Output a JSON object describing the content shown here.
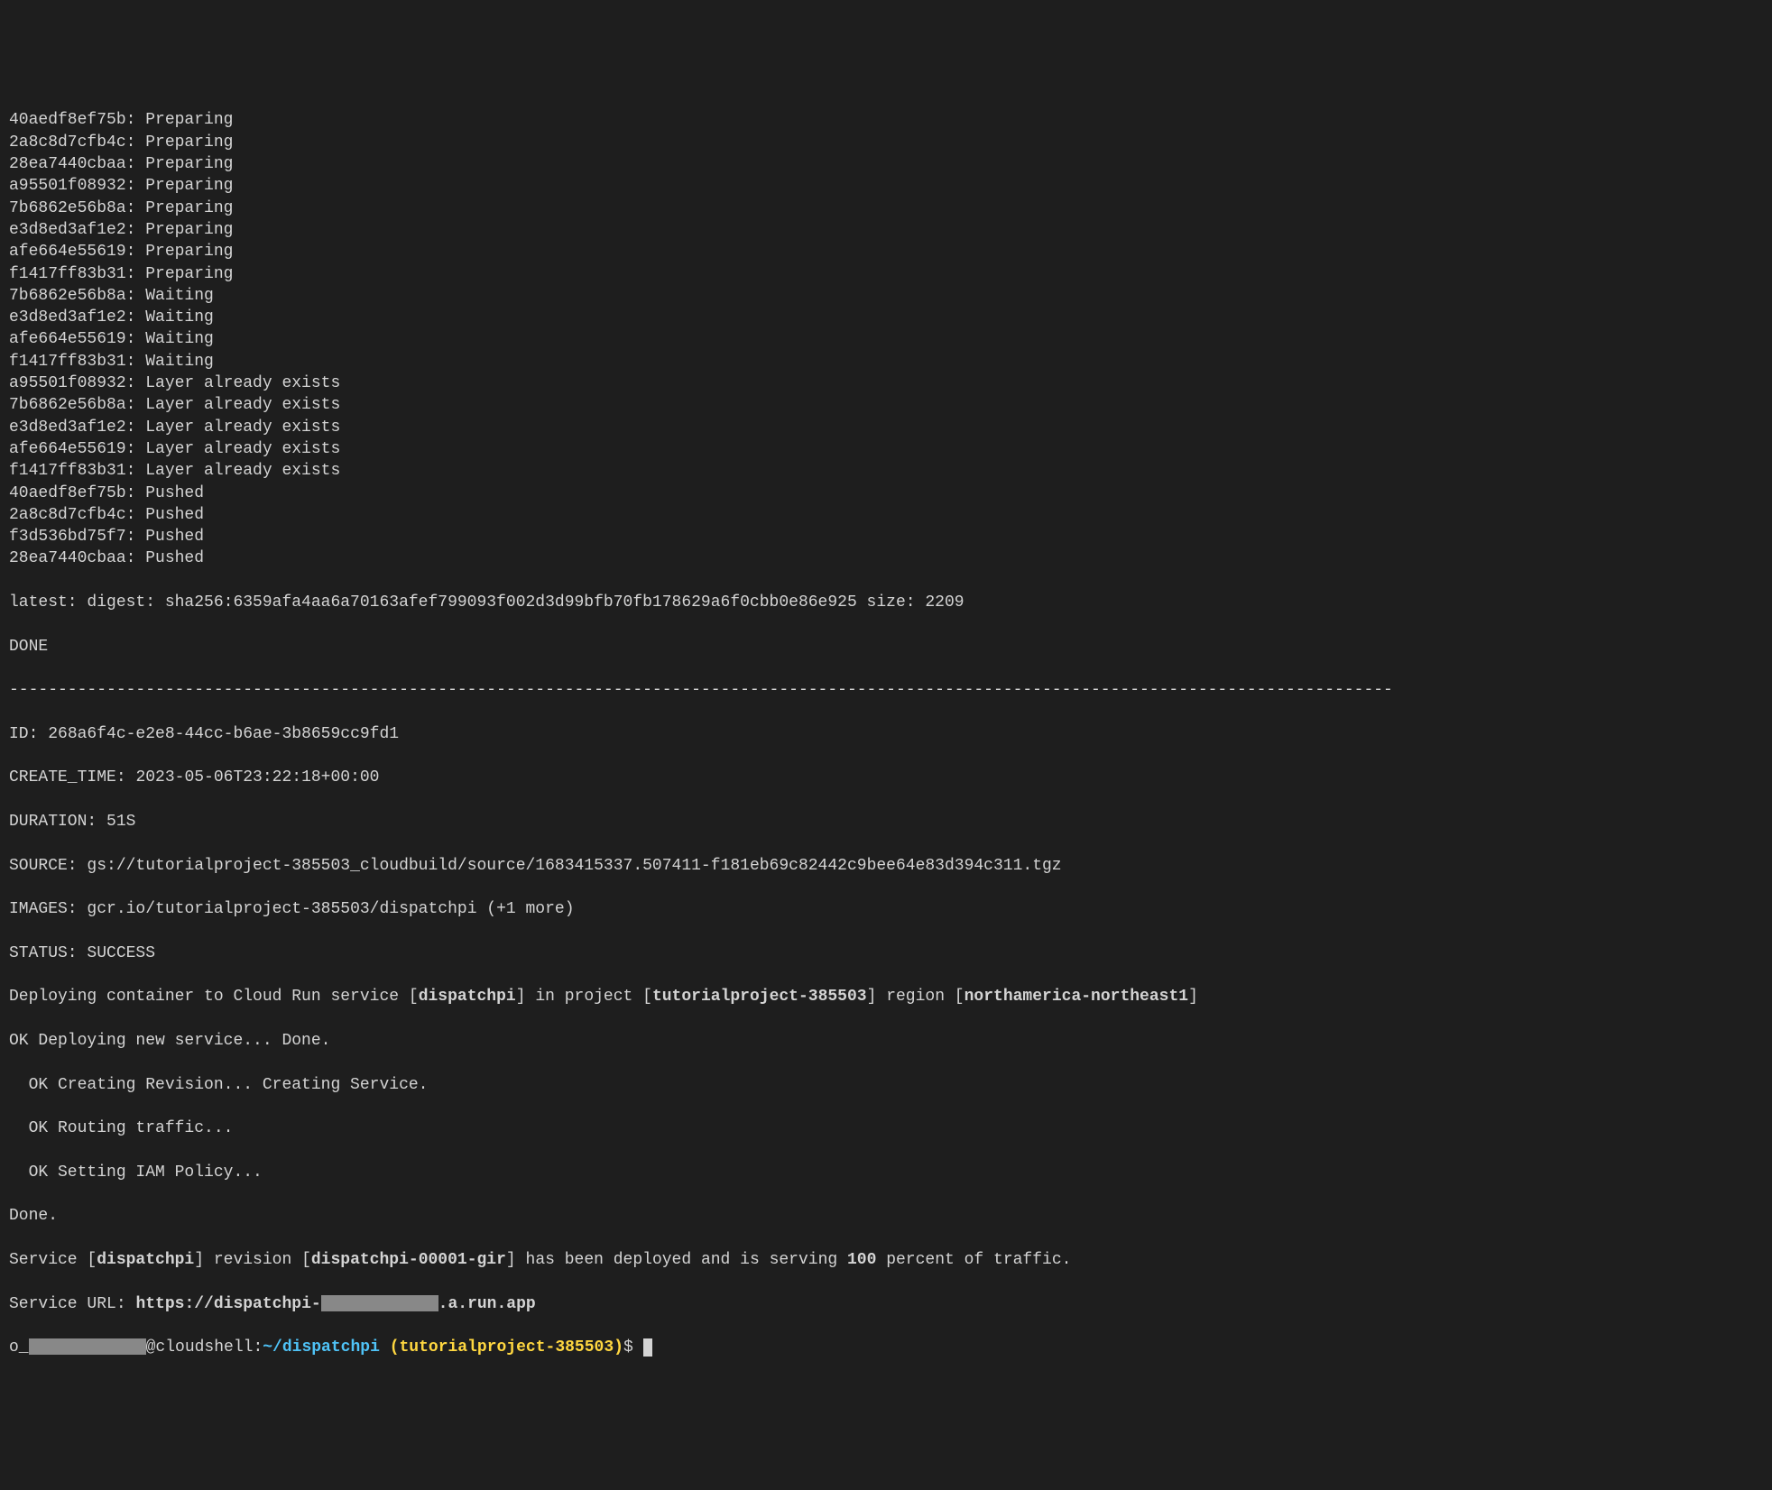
{
  "terminal": {
    "layers": [
      {
        "hash": "40aedf8ef75b",
        "status": "Preparing"
      },
      {
        "hash": "2a8c8d7cfb4c",
        "status": "Preparing"
      },
      {
        "hash": "28ea7440cbaa",
        "status": "Preparing"
      },
      {
        "hash": "a95501f08932",
        "status": "Preparing"
      },
      {
        "hash": "7b6862e56b8a",
        "status": "Preparing"
      },
      {
        "hash": "e3d8ed3af1e2",
        "status": "Preparing"
      },
      {
        "hash": "afe664e55619",
        "status": "Preparing"
      },
      {
        "hash": "f1417ff83b31",
        "status": "Preparing"
      },
      {
        "hash": "7b6862e56b8a",
        "status": "Waiting"
      },
      {
        "hash": "e3d8ed3af1e2",
        "status": "Waiting"
      },
      {
        "hash": "afe664e55619",
        "status": "Waiting"
      },
      {
        "hash": "f1417ff83b31",
        "status": "Waiting"
      },
      {
        "hash": "a95501f08932",
        "status": "Layer already exists"
      },
      {
        "hash": "7b6862e56b8a",
        "status": "Layer already exists"
      },
      {
        "hash": "e3d8ed3af1e2",
        "status": "Layer already exists"
      },
      {
        "hash": "afe664e55619",
        "status": "Layer already exists"
      },
      {
        "hash": "f1417ff83b31",
        "status": "Layer already exists"
      },
      {
        "hash": "40aedf8ef75b",
        "status": "Pushed"
      },
      {
        "hash": "2a8c8d7cfb4c",
        "status": "Pushed"
      },
      {
        "hash": "f3d536bd75f7",
        "status": "Pushed"
      },
      {
        "hash": "28ea7440cbaa",
        "status": "Pushed"
      }
    ],
    "digest_line": "latest: digest: sha256:6359afa4aa6a70163afef799093f002d3d99bfb70fb178629a6f0cbb0e86e925 size: 2209",
    "done": "DONE",
    "separator": "----------------------------------------------------------------------------------------------------------------------------------------------",
    "build": {
      "id_label": "ID: ",
      "id": "268a6f4c-e2e8-44cc-b6ae-3b8659cc9fd1",
      "create_time_label": "CREATE_TIME: ",
      "create_time": "2023-05-06T23:22:18+00:00",
      "duration_label": "DURATION: ",
      "duration": "51S",
      "source_label": "SOURCE: ",
      "source": "gs://tutorialproject-385503_cloudbuild/source/1683415337.507411-f181eb69c82442c9bee64e83d394c311.tgz",
      "images_label": "IMAGES: ",
      "images": "gcr.io/tutorialproject-385503/dispatchpi (+1 more)",
      "status_label": "STATUS: ",
      "status": "SUCCESS"
    },
    "deploy": {
      "prefix": "Deploying container to Cloud Run service [",
      "service": "dispatchpi",
      "mid1": "] in project [",
      "project": "tutorialproject-385503",
      "mid2": "] region [",
      "region": "northamerica-northeast1",
      "suffix": "]"
    },
    "steps": {
      "line1": "OK Deploying new service... Done.",
      "line2": "  OK Creating Revision... Creating Service.",
      "line3": "  OK Routing traffic...",
      "line4": "  OK Setting IAM Policy...",
      "done": "Done."
    },
    "revision": {
      "prefix": "Service [",
      "service": "dispatchpi",
      "mid1": "] revision [",
      "revision": "dispatchpi-00001-gir",
      "mid2": "] has been deployed and is serving ",
      "percent": "100",
      "suffix": " percent of traffic."
    },
    "url": {
      "label": "Service URL: ",
      "prefix": "https://dispatchpi-",
      "suffix": ".a.run.app"
    },
    "prompt": {
      "user_prefix": "o_",
      "at": "@cloudshell",
      "colon": ":",
      "path": "~/dispatchpi",
      "space": " ",
      "project": "(tutorialproject-385503)",
      "dollar": "$ "
    }
  }
}
